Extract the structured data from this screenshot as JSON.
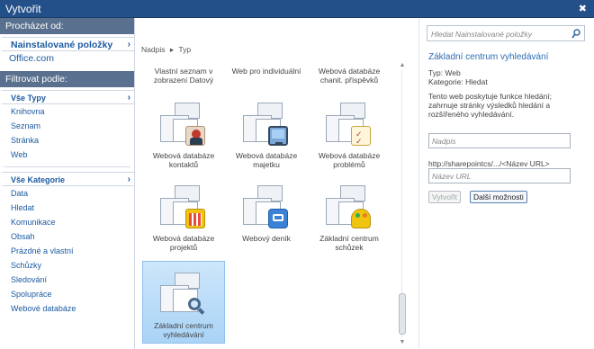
{
  "window": {
    "title": "Vytvořit",
    "close_glyph": "✖"
  },
  "left": {
    "browse_header": "Procházet od:",
    "browse_items": [
      {
        "label": "Nainstalované položky",
        "selected": true
      },
      {
        "label": "Office.com",
        "selected": false
      }
    ],
    "filter_header": "Filtrovat podle:",
    "types_header": "Vše Typy",
    "types": [
      "Knihovna",
      "Seznam",
      "Stránka",
      "Web"
    ],
    "categories_header": "Vše Kategorie",
    "categories": [
      "Data",
      "Hledat",
      "Komunikace",
      "Obsah",
      "Prázdné a vlastní",
      "Schůzky",
      "Sledování",
      "Spolupráce",
      "Webové databáze"
    ]
  },
  "center": {
    "sort": {
      "name": "Nadpis",
      "type": "Typ",
      "arrow": "▸"
    },
    "tiles": [
      {
        "label": "Vlastní seznam v zobrazení Datový",
        "icon": "datasheet-list-icon"
      },
      {
        "label": "Web pro individuální",
        "icon": "personal-web-icon"
      },
      {
        "label": "Webová databáze chanit. příspěvků",
        "icon": "contributions-db-icon"
      },
      {
        "label": "Webová databáze kontaktů",
        "icon": "contacts-db-icon"
      },
      {
        "label": "Webová databáze majetku",
        "icon": "assets-db-icon"
      },
      {
        "label": "Webová databáze problémů",
        "icon": "issues-db-icon"
      },
      {
        "label": "Webová databáze projektů",
        "icon": "projects-db-icon"
      },
      {
        "label": "Webový deník",
        "icon": "blog-icon"
      },
      {
        "label": "Základní centrum schůzek",
        "icon": "meeting-workspace-icon"
      },
      {
        "label": "Základní centrum vyhledávání",
        "icon": "search-center-icon",
        "selected": true
      }
    ]
  },
  "right": {
    "search_placeholder": "Hledat Nainstalované položky",
    "title": "Základní centrum vyhledávání",
    "type_line": "Typ: Web",
    "category_line": "Kategorie: Hledat",
    "description": "Tento web poskytuje funkce hledání; zahrnuje stránky výsledků hledání a rozšířeného vyhledávání.",
    "name_placeholder": "Nadpis",
    "url_prefix": "http://sharepointcs/.../<Název URL>",
    "url_placeholder": "Název URL",
    "create_button": "Vytvořit",
    "more_button": "Další možnosti"
  },
  "colors": {
    "titlebar": "#24508a",
    "section_header": "#59708e",
    "link": "#1c5aa0",
    "selected_tile": "#b9dcf8"
  }
}
